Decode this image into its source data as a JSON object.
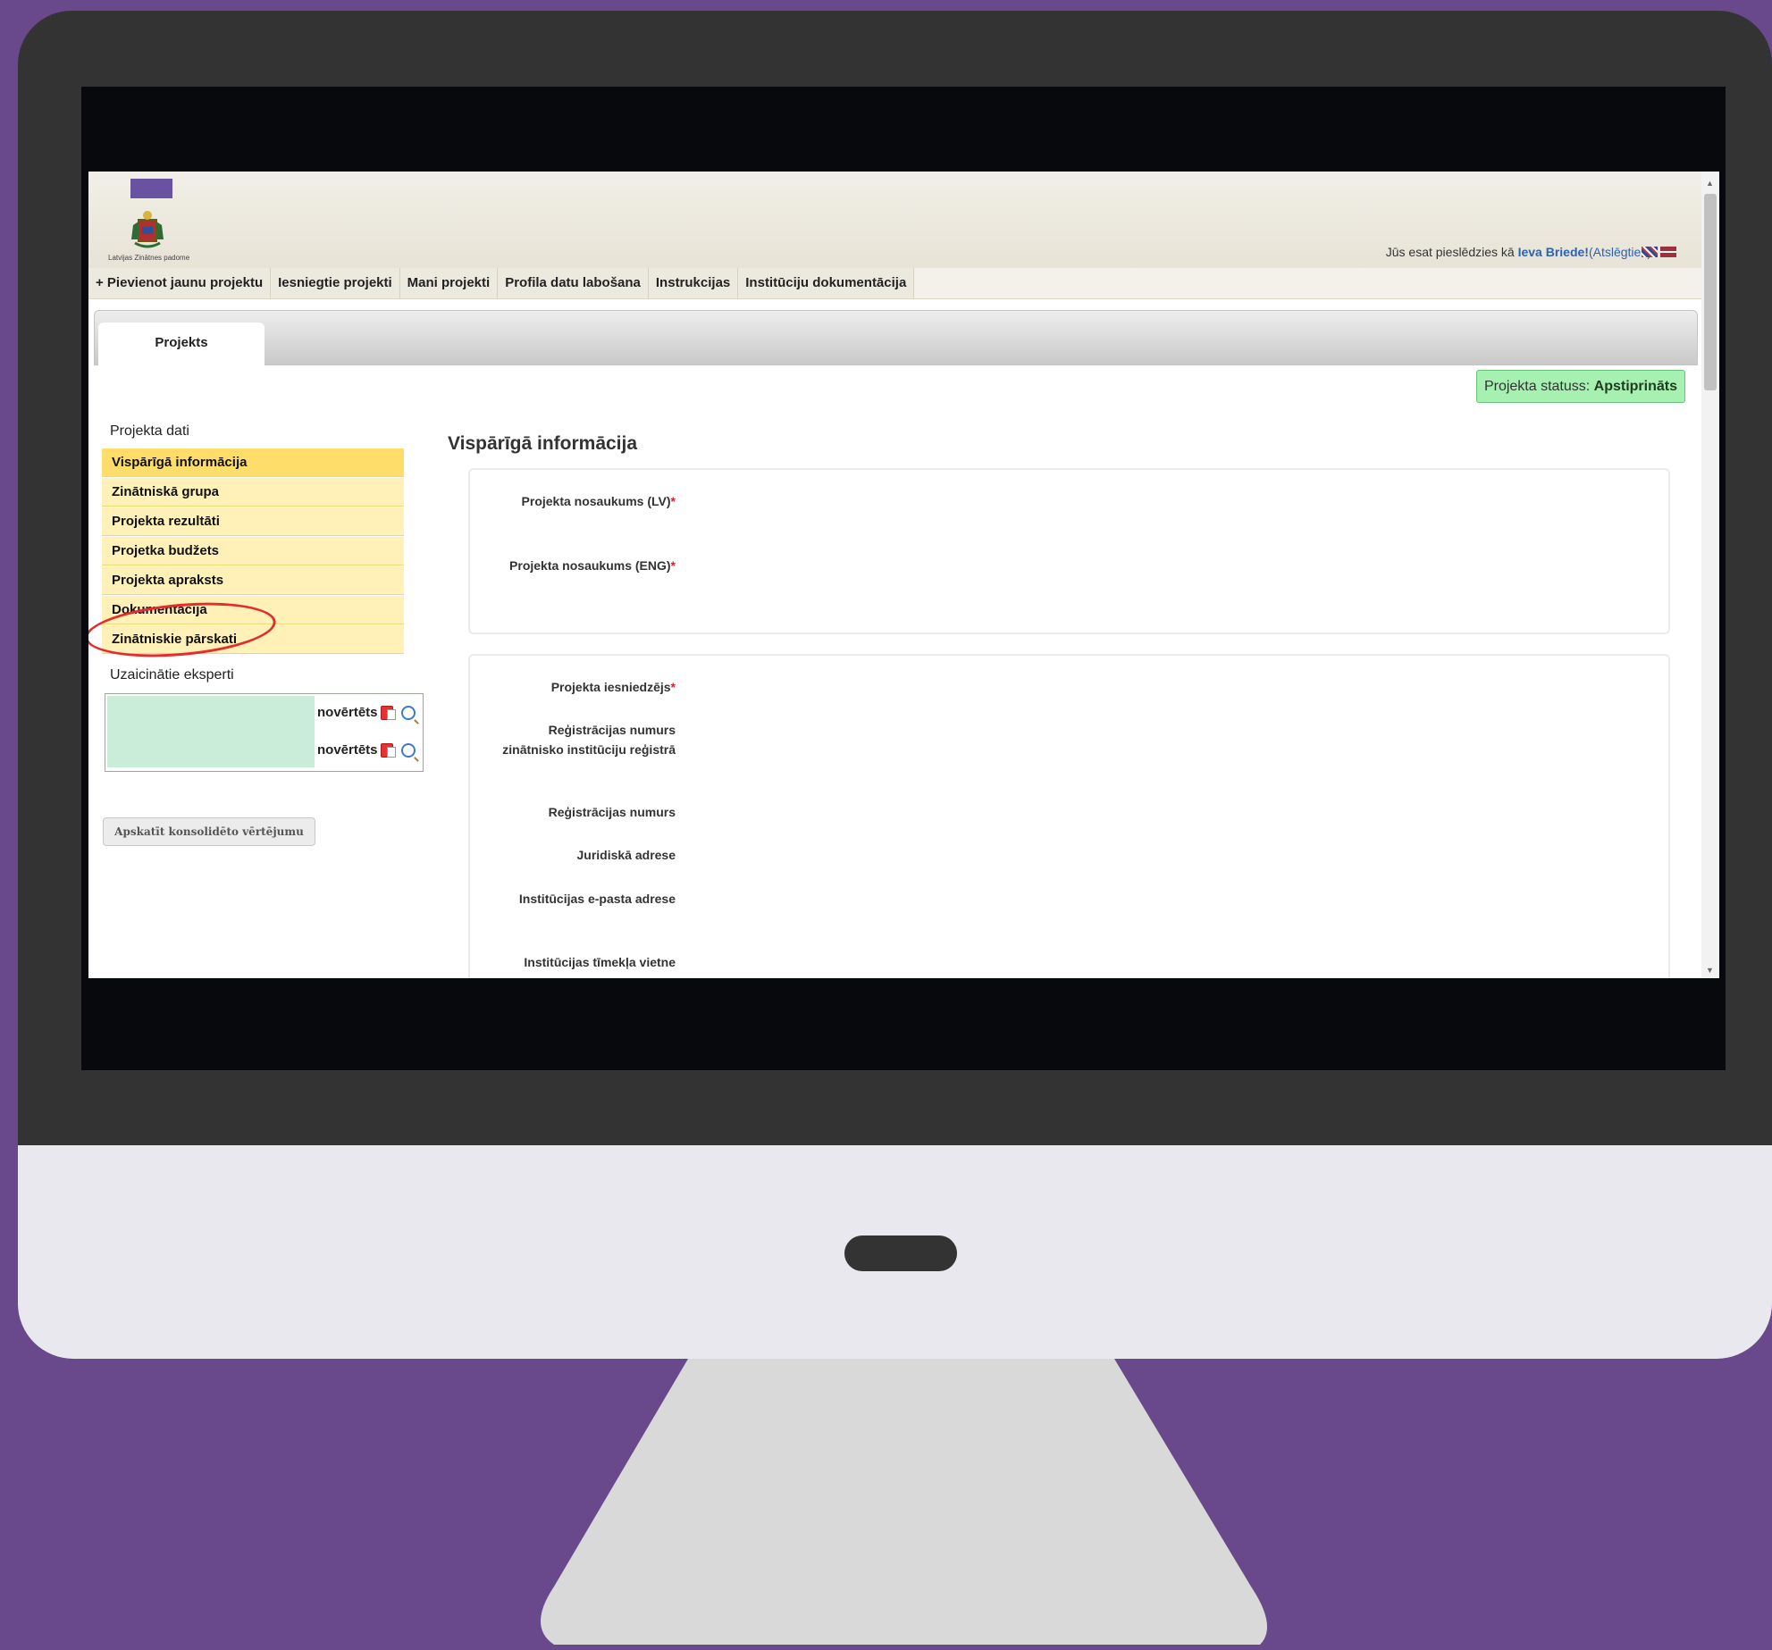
{
  "header": {
    "org_name": "Latvijas Zinātnes padome",
    "login_prefix": "Jūs esat pieslēdzies kā ",
    "user_name": "Ieva Briede!",
    "logout_label": "(Atslēgties)"
  },
  "menu": {
    "items": [
      {
        "label": "+ Pievienot jaunu projektu"
      },
      {
        "label": "Iesniegtie projekti"
      },
      {
        "label": "Mani projekti"
      },
      {
        "label": "Profila datu labošana"
      },
      {
        "label": "Instrukcijas"
      },
      {
        "label": "Institūciju dokumentācija"
      }
    ]
  },
  "tabs": {
    "project": "Projekts"
  },
  "status": {
    "label": "Projekta statuss: ",
    "value": "Apstiprināts"
  },
  "sidebar": {
    "title": "Projekta dati",
    "items": [
      {
        "label": "Vispārīgā informācija",
        "active": true
      },
      {
        "label": "Zinātniskā grupa"
      },
      {
        "label": "Projekta rezultāti"
      },
      {
        "label": "Projetka budžets"
      },
      {
        "label": "Projekta apraksts"
      },
      {
        "label": "Dokumentācija"
      },
      {
        "label": "Zinātniskie pārskati"
      }
    ],
    "experts_title": "Uzaicinātie eksperti",
    "experts": [
      {
        "status": "novērtēts"
      },
      {
        "status": "novērtēts"
      }
    ],
    "consolidated_button": "Apskatīt konsolidēto vērtējumu"
  },
  "main": {
    "title": "Vispārīgā informācija",
    "fields_group1": [
      {
        "label": "Projekta nosaukums (LV)",
        "required": true
      },
      {
        "label": "Projekta nosaukums (ENG)",
        "required": true
      }
    ],
    "fields_group2": [
      {
        "label": "Projekta iesniedzējs",
        "required": true
      },
      {
        "label": "Reģistrācijas numurs zinātnisko institūciju reģistrā"
      },
      {
        "label": "Reģistrācijas numurs"
      },
      {
        "label": "Juridiskā adrese"
      },
      {
        "label": "Institūcijas e-pasta adrese"
      },
      {
        "label": "Institūcijas tīmekļa vietne"
      }
    ]
  },
  "colors": {
    "background": "#69498c",
    "frame": "#333333",
    "active_nav": "#fedd6b",
    "nav": "#fff1b8",
    "status_badge": "#a6f0b2",
    "highlight": "#e52b2b",
    "link": "#2b62b4"
  },
  "icons": [
    "crest-icon",
    "flag-en-icon",
    "flag-lv-icon",
    "pdf-icon",
    "magnifier-icon"
  ]
}
